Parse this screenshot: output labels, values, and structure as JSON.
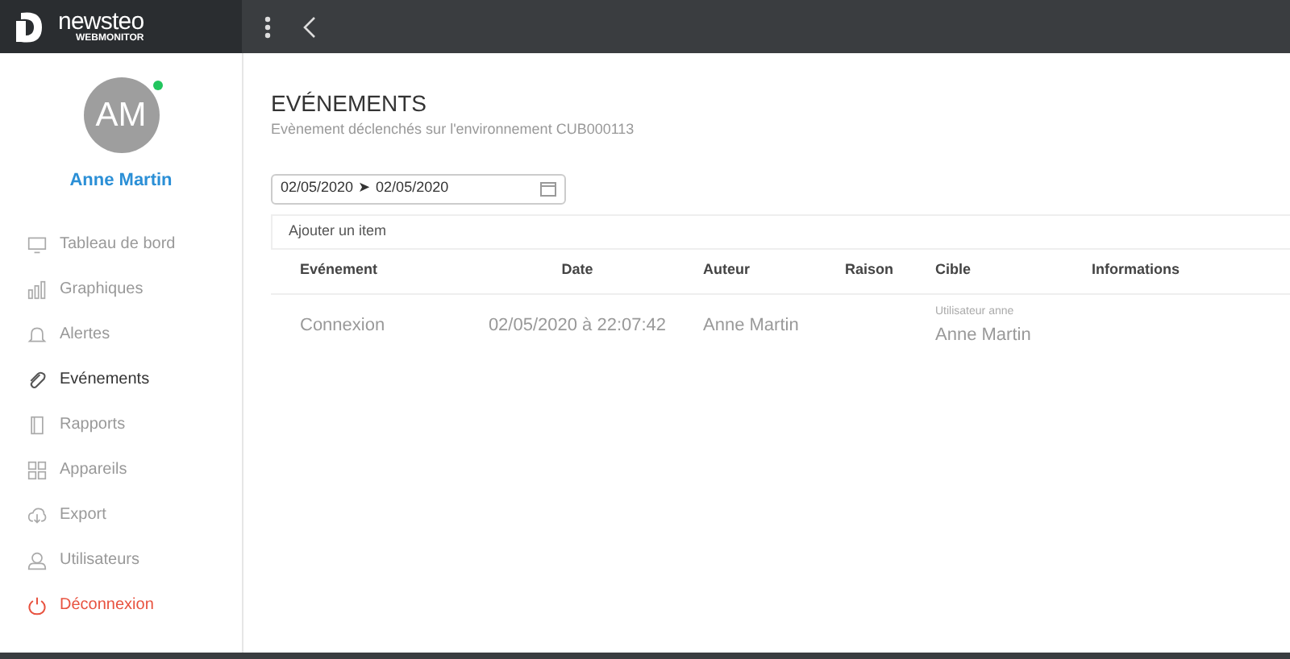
{
  "header": {
    "logo_text": "newsteo",
    "logo_subtext": "WEBMONITOR"
  },
  "user": {
    "initials": "AM",
    "name": "Anne Martin",
    "online": true
  },
  "sidebar": {
    "items": [
      {
        "label": "Tableau de bord",
        "kind": "monitor",
        "selected": false
      },
      {
        "label": "Graphiques",
        "kind": "chart",
        "selected": false
      },
      {
        "label": "Alertes",
        "kind": "bell",
        "selected": false
      },
      {
        "label": "Evénements",
        "kind": "clip",
        "selected": true
      },
      {
        "label": "Rapports",
        "kind": "report",
        "selected": false
      },
      {
        "label": "Appareils",
        "kind": "grid",
        "selected": false
      },
      {
        "label": "Export",
        "kind": "cloud",
        "selected": false
      },
      {
        "label": "Utilisateurs",
        "kind": "user",
        "selected": false
      },
      {
        "label": "Déconnexion",
        "kind": "power",
        "selected": false
      }
    ]
  },
  "page": {
    "title": "EVÉNEMENTS",
    "subtitle": "Evènement déclenchés sur l'environnement CUB000113",
    "date_range": {
      "from": "02/05/2020",
      "separator": "➤",
      "to": "02/05/2020"
    },
    "add_item": "Ajouter un item"
  },
  "table": {
    "columns": [
      "Evénement",
      "Date",
      "Auteur",
      "Raison",
      "Cible",
      "Informations"
    ],
    "rows": [
      {
        "event": "Connexion",
        "date": "02/05/2020 à 22:07:42",
        "author": "Anne Martin",
        "reason": "",
        "target_label": "Utilisateur anne",
        "target": "Anne Martin",
        "info": ""
      }
    ]
  }
}
